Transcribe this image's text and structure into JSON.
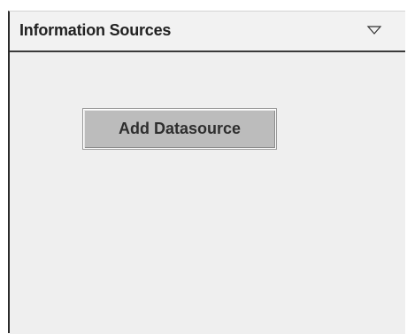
{
  "panel": {
    "title": "Information Sources",
    "toggle_icon": "chevron-down-icon"
  },
  "body": {
    "add_button_label": "Add Datasource"
  },
  "colors": {
    "panel_background": "#efefef",
    "button_background": "#bcbcbc",
    "text": "#222222"
  }
}
